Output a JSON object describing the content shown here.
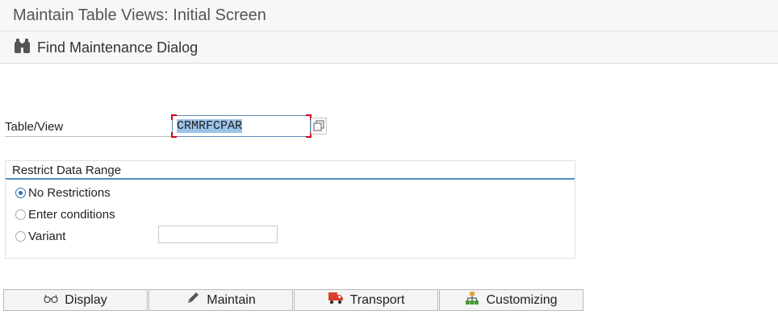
{
  "window": {
    "title": "Maintain Table Views: Initial Screen"
  },
  "toolbar": {
    "find_label": "Find Maintenance Dialog",
    "find_icon": "binoculars-icon"
  },
  "table_view": {
    "label": "Table/View",
    "value": "CRMRFCPAR"
  },
  "restrict": {
    "title": "Restrict Data Range",
    "options": [
      {
        "label": "No Restrictions",
        "checked": true
      },
      {
        "label": "Enter conditions",
        "checked": false
      },
      {
        "label": "Variant",
        "checked": false
      }
    ],
    "variant_value": ""
  },
  "buttons": {
    "display": {
      "label": "Display",
      "icon": "glasses-icon"
    },
    "maintain": {
      "label": "Maintain",
      "icon": "pencil-icon"
    },
    "transport": {
      "label": "Transport",
      "icon": "truck-icon"
    },
    "customizing": {
      "label": "Customizing",
      "icon": "hierarchy-icon"
    }
  },
  "colors": {
    "accent": "#4a90c2",
    "required_marker": "#d0021b",
    "selection": "#9cc3e8"
  }
}
